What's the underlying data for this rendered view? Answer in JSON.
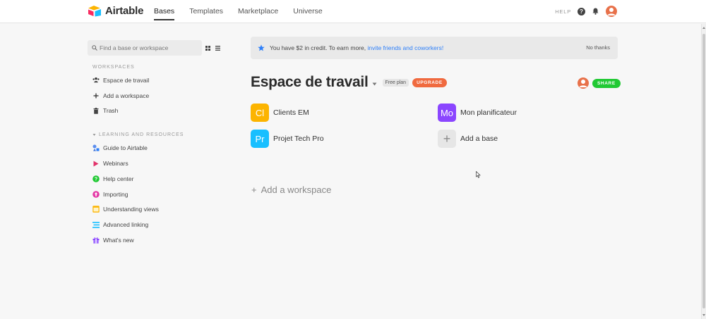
{
  "app": {
    "brand": "Airtable",
    "nav": [
      "Bases",
      "Templates",
      "Marketplace",
      "Universe"
    ],
    "active_nav": "Bases",
    "help_label": "HELP"
  },
  "sidebar": {
    "search_placeholder": "Find a base or workspace",
    "workspaces_title": "WORKSPACES",
    "workspace_items": [
      {
        "label": "Espace de travail",
        "icon": "people-icon"
      },
      {
        "label": "Add a workspace",
        "icon": "plus-icon"
      },
      {
        "label": "Trash",
        "icon": "trash-icon"
      }
    ],
    "resources_title": "LEARNING AND RESOURCES",
    "resource_items": [
      {
        "label": "Guide to Airtable",
        "icon": "shapes-icon"
      },
      {
        "label": "Webinars",
        "icon": "play-icon"
      },
      {
        "label": "Help center",
        "icon": "question-icon"
      },
      {
        "label": "Importing",
        "icon": "import-icon"
      },
      {
        "label": "Understanding views",
        "icon": "views-icon"
      },
      {
        "label": "Advanced linking",
        "icon": "linking-icon"
      },
      {
        "label": "What's new",
        "icon": "gift-icon"
      }
    ]
  },
  "banner": {
    "text": "You have $2 in credit. To earn more,",
    "link": "invite friends and coworkers!",
    "dismiss": "No thanks"
  },
  "workspace": {
    "title": "Espace de travail",
    "plan": "Free plan",
    "upgrade": "UPGRADE",
    "share": "SHARE",
    "bases": [
      {
        "abbr": "Cl",
        "name": "Clients EM",
        "color": "#fcb400"
      },
      {
        "abbr": "Mo",
        "name": "Mon planificateur",
        "color": "#8b46ff"
      },
      {
        "abbr": "Pr",
        "name": "Projet Tech Pro",
        "color": "#18bfff"
      }
    ],
    "add_base": "Add a base"
  },
  "add_workspace": "Add a workspace",
  "colors": {
    "accent_link": "#2d7ff9",
    "upgrade": "#f06a3f",
    "share": "#20c933"
  }
}
